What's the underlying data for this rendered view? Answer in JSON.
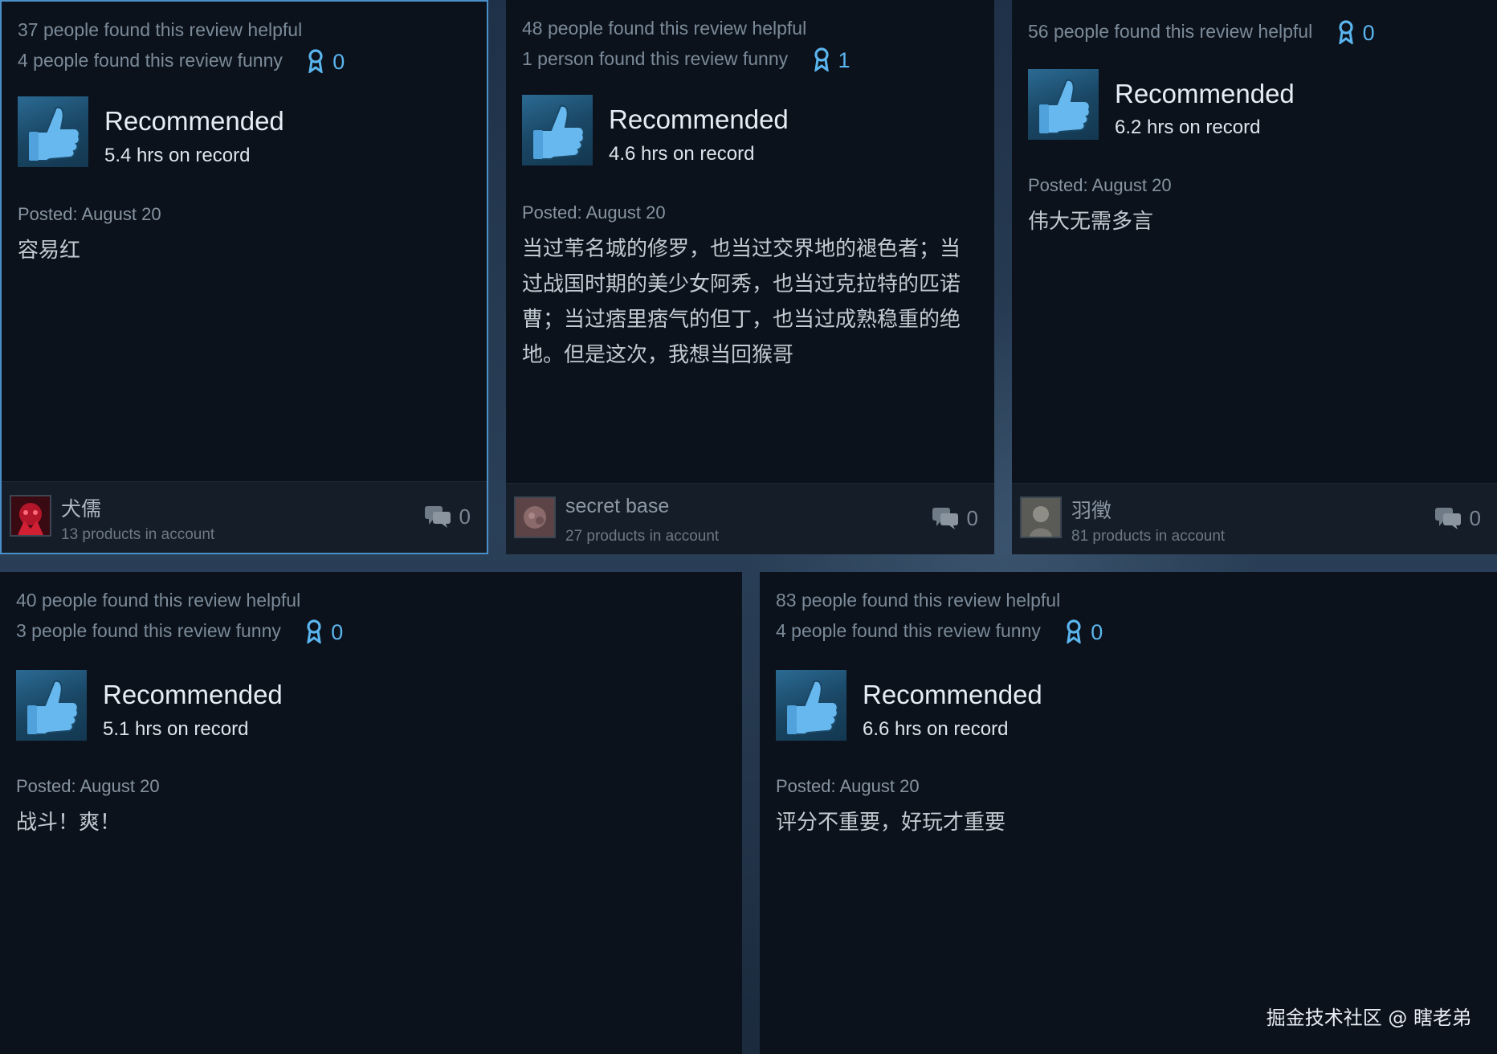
{
  "reviews": [
    {
      "helpful": "37 people found this review helpful",
      "funny": "4 people found this review funny",
      "awards": "0",
      "recommendation": "Recommended",
      "hours": "5.4 hrs on record",
      "posted": "Posted: August 20",
      "content": "容易红",
      "author": "犬儒",
      "products": "13 products in account",
      "comments": "0"
    },
    {
      "helpful": "48 people found this review helpful",
      "funny": "1 person found this review funny",
      "awards": "1",
      "recommendation": "Recommended",
      "hours": "4.6 hrs on record",
      "posted": "Posted: August 20",
      "content": "当过苇名城的修罗，也当过交界地的褪色者；当过战国时期的美少女阿秀，也当过克拉特的匹诺曹；当过痞里痞气的但丁，也当过成熟稳重的绝地。但是这次，我想当回猴哥",
      "author": "secret base",
      "products": "27 products in account",
      "comments": "0"
    },
    {
      "helpful": "56 people found this review helpful",
      "funny": "",
      "awards": "0",
      "recommendation": "Recommended",
      "hours": "6.2 hrs on record",
      "posted": "Posted: August 20",
      "content": "伟大无需多言",
      "author": "羽徵",
      "products": "81 products in account",
      "comments": "0"
    },
    {
      "helpful": "40 people found this review helpful",
      "funny": "3 people found this review funny",
      "awards": "0",
      "recommendation": "Recommended",
      "hours": "5.1 hrs on record",
      "posted": "Posted: August 20",
      "content": "战斗！爽！"
    },
    {
      "helpful": "83 people found this review helpful",
      "funny": "4 people found this review funny",
      "awards": "0",
      "recommendation": "Recommended",
      "hours": "6.6 hrs on record",
      "posted": "Posted: August 20",
      "content": "评分不重要，好玩才重要"
    }
  ],
  "watermark": "掘金技术社区 @ 瞎老弟",
  "colors": {
    "card_bg": "#0b121b",
    "footer_bg": "#141d28",
    "award_blue": "#5bb5ef",
    "active_border": "#4a8fc7"
  },
  "icons": {
    "award": "award-ribbon-icon",
    "thumb": "thumbs-up-icon",
    "comment": "comment-bubbles-icon"
  }
}
